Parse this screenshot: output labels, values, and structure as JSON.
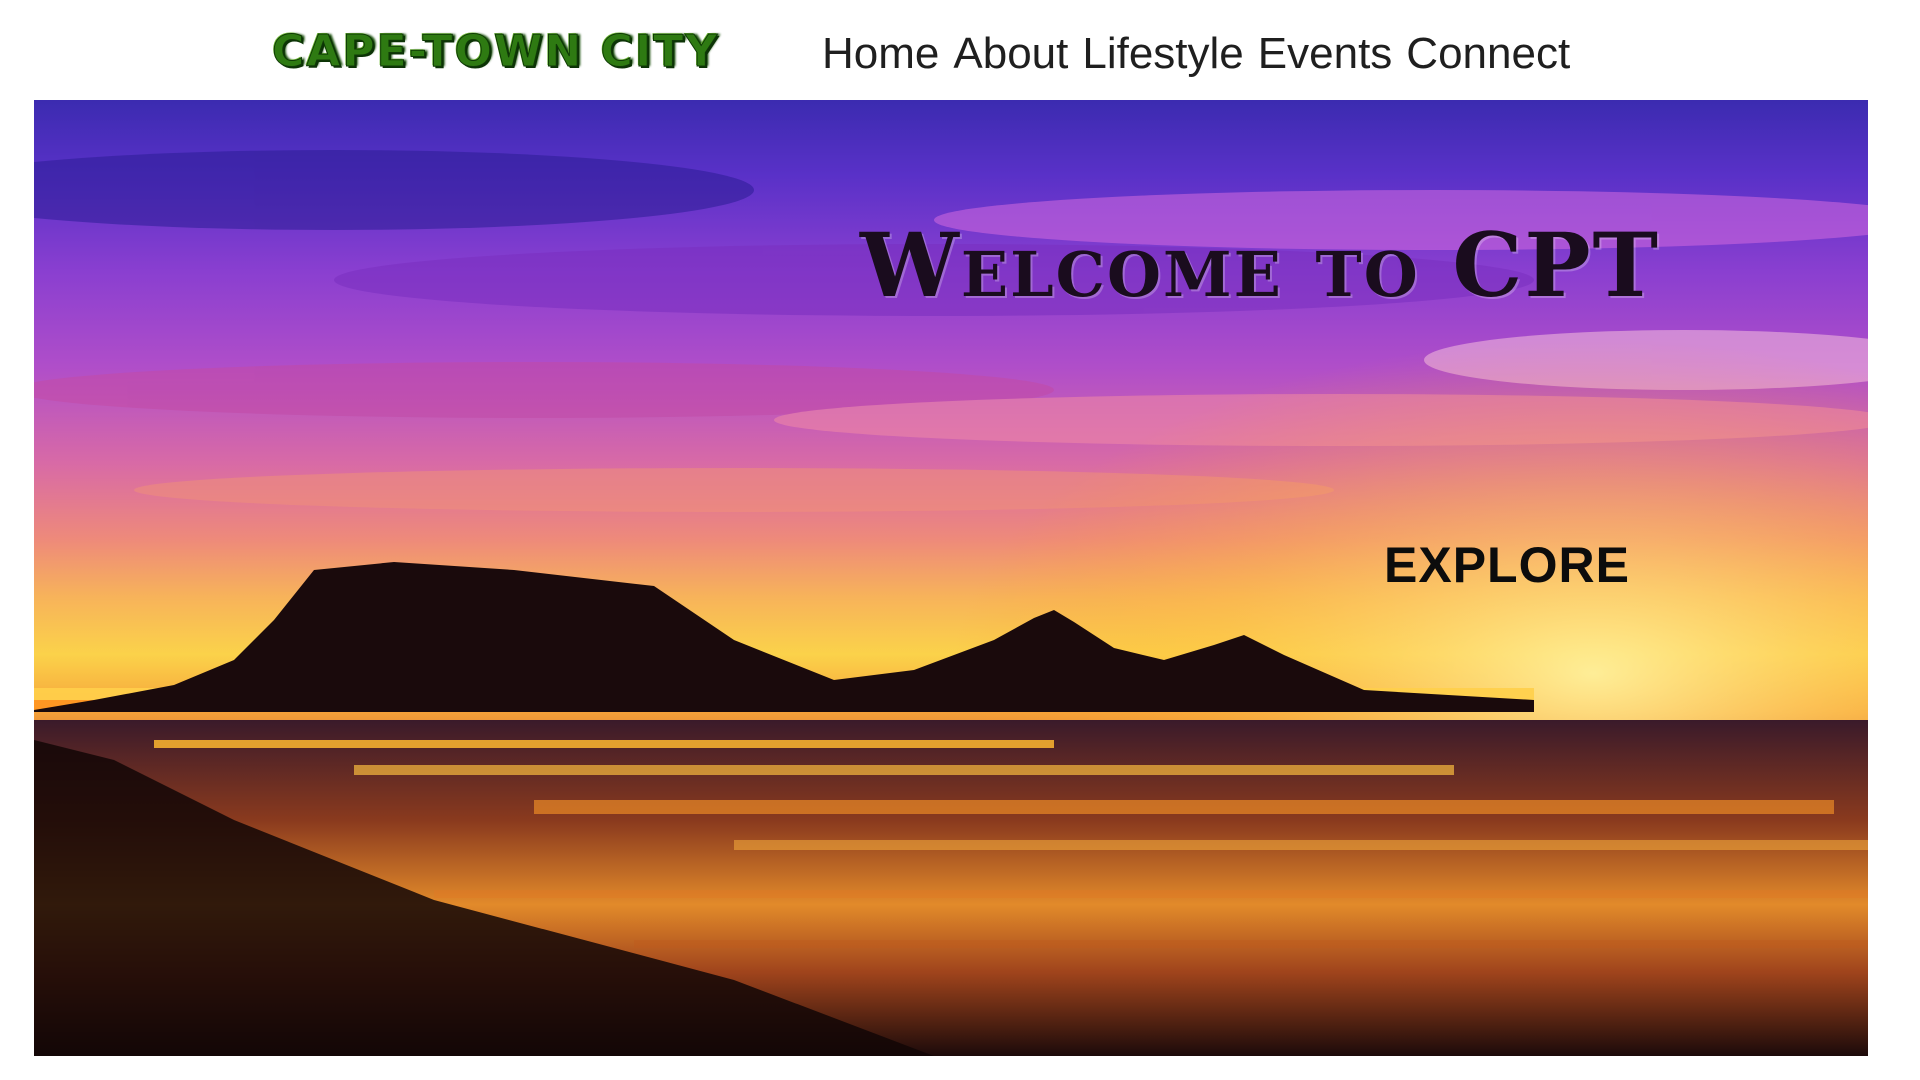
{
  "header": {
    "logo_text": "CAPE-TOWN CITY",
    "nav": [
      {
        "label": "Home"
      },
      {
        "label": "About"
      },
      {
        "label": "Lifestyle"
      },
      {
        "label": "Events"
      },
      {
        "label": "Connect"
      }
    ]
  },
  "hero": {
    "title": "Welcome to CPT",
    "cta_label": "EXPLORE",
    "image": "table-mountain-sunset-image"
  },
  "colors": {
    "logo_green": "#2e7a12",
    "nav_text": "#1f1f1f",
    "sky_purple": "#5a31c8",
    "sky_sunset": "#fbd24a"
  }
}
